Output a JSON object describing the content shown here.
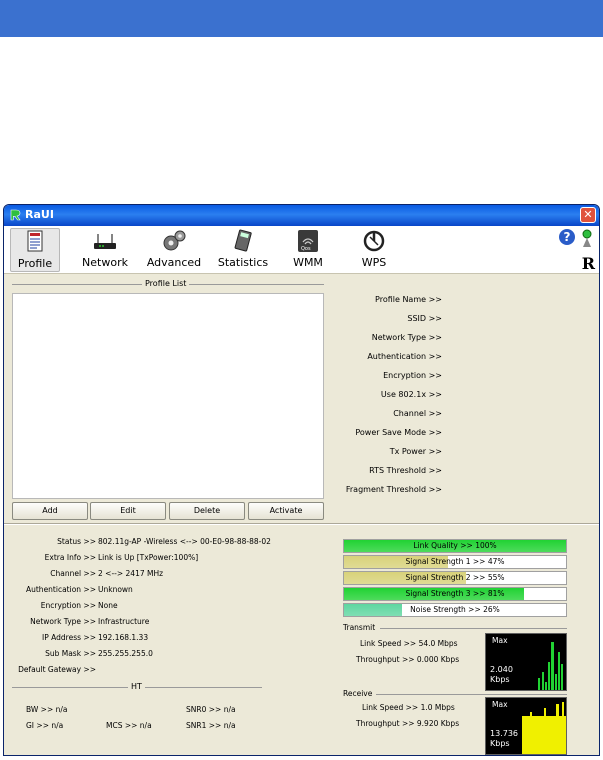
{
  "window": {
    "title": "RaUI",
    "close_glyph": "✕"
  },
  "toolbar": {
    "items": [
      {
        "label": "Profile",
        "icon": "profile-icon"
      },
      {
        "label": "Network",
        "icon": "network-icon"
      },
      {
        "label": "Advanced",
        "icon": "advanced-icon"
      },
      {
        "label": "Statistics",
        "icon": "statistics-icon"
      },
      {
        "label": "WMM",
        "icon": "wmm-icon"
      },
      {
        "label": "WPS",
        "icon": "wps-icon"
      }
    ],
    "help_glyph": "?",
    "logo_text": "R"
  },
  "profile": {
    "list_title": "Profile List",
    "buttons": {
      "add": "Add",
      "edit": "Edit",
      "delete": "Delete",
      "activate": "Activate"
    },
    "fields": [
      "Profile Name >>",
      "SSID >>",
      "Network Type >>",
      "Authentication >>",
      "Encryption >>",
      "Use 802.1x >>",
      "Channel >>",
      "Power Save Mode >>",
      "Tx Power >>",
      "RTS Threshold >>",
      "Fragment Threshold >>"
    ]
  },
  "status": {
    "rows": [
      {
        "label": "Status >>",
        "value": "802.11g-AP -Wireless <--> 00-E0-98-88-88-02"
      },
      {
        "label": "Extra Info >>",
        "value": "Link is Up [TxPower:100%]"
      },
      {
        "label": "Channel >>",
        "value": "2 <--> 2417 MHz"
      },
      {
        "label": "Authentication >>",
        "value": "Unknown"
      },
      {
        "label": "Encryption >>",
        "value": "None"
      },
      {
        "label": "Network Type >>",
        "value": "Infrastructure"
      },
      {
        "label": "IP Address >>",
        "value": "192.168.1.33"
      },
      {
        "label": "Sub Mask >>",
        "value": "255.255.255.0"
      },
      {
        "label": "Default Gateway >>",
        "value": ""
      }
    ],
    "ht_title": "HT",
    "ht": {
      "bw": "BW >> n/a",
      "gi": "GI >> n/a",
      "mcs": "MCS >> n/a",
      "snr0": "SNR0 >> n/a",
      "snr1": "SNR1 >> n/a"
    }
  },
  "signal": {
    "meters": [
      {
        "text": "Link Quality >> 100%",
        "level": 1.0,
        "color": "#21d233"
      },
      {
        "text": "Signal Strength 1 >> 47%",
        "level": 0.47,
        "color": "#d8d27a"
      },
      {
        "text": "Signal Strength 2 >> 55%",
        "level": 0.55,
        "color": "#d8d27a"
      },
      {
        "text": "Signal Strength 3 >> 81%",
        "level": 0.81,
        "color": "#21d233"
      },
      {
        "text": "Noise Strength >> 26%",
        "level": 0.26,
        "color": "#5fd6a0"
      }
    ]
  },
  "transmit": {
    "title": "Transmit",
    "link_speed": "Link Speed >> 54.0 Mbps",
    "throughput": "Throughput >> 0.000 Kbps",
    "graph_max": "Max",
    "graph_value": "2.040",
    "graph_unit": "Kbps",
    "graph_color": "#21d233"
  },
  "receive": {
    "title": "Receive",
    "link_speed": "Link Speed >> 1.0 Mbps",
    "throughput": "Throughput >> 9.920 Kbps",
    "graph_max": "Max",
    "graph_value": "13.736",
    "graph_unit": "Kbps",
    "graph_color": "#f0f000"
  }
}
